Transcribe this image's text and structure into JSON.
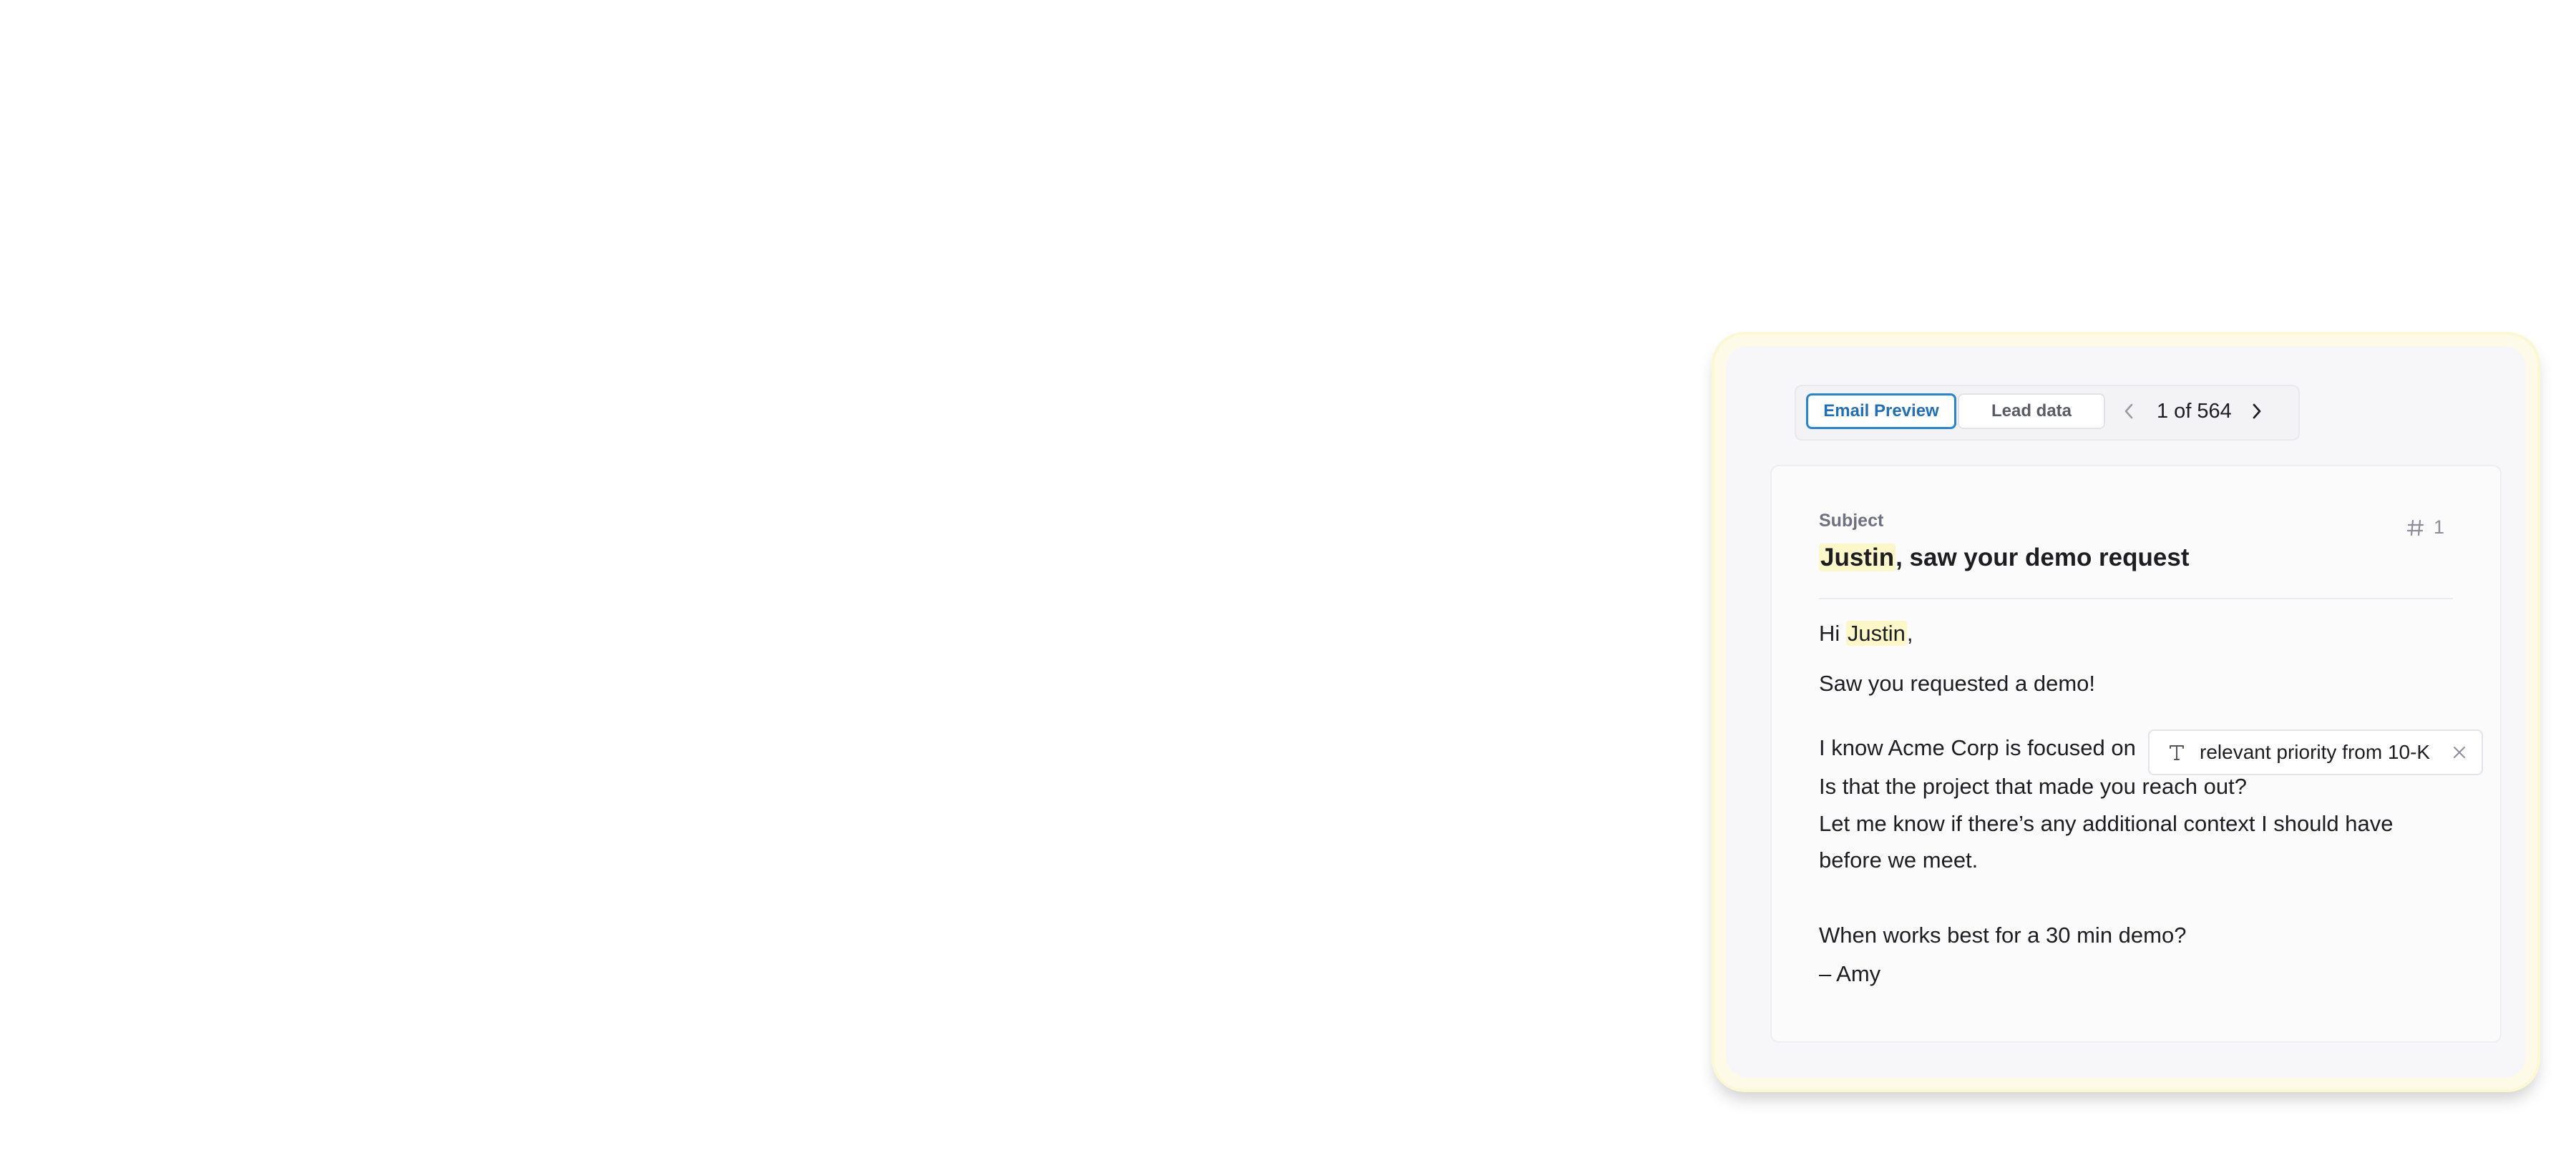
{
  "toolbar": {
    "tab_email_preview": "Email Preview",
    "tab_lead_data": "Lead data",
    "pager_text": "1 of 564",
    "prev_icon": "chevron-left-icon",
    "next_icon": "chevron-right-icon"
  },
  "email": {
    "subject_label": "Subject",
    "step_icon": "hash-icon",
    "step_number": "1",
    "subject_name": "Justin",
    "subject_rest": ", saw your demo request",
    "greeting_prefix": "Hi ",
    "greeting_name": "Justin",
    "greeting_suffix": ",",
    "line_saw": "Saw you requested a demo!",
    "line_focus": "I know Acme Corp is focused on",
    "variable_chip": {
      "icon": "text-type-icon",
      "label": "relevant priority from 10-K",
      "remove_icon": "close-icon"
    },
    "line_project": "Is that the project that made you reach out?",
    "line_context_1": "Let me know if there’s any additional context I should have",
    "line_context_2": "before we meet.",
    "line_when": "When works best for a 30 min demo?",
    "signature": "– Amy"
  },
  "colors": {
    "accent": "#2584d8",
    "highlight": "#fbf7c8",
    "card_glow": "#fdfbe8"
  }
}
